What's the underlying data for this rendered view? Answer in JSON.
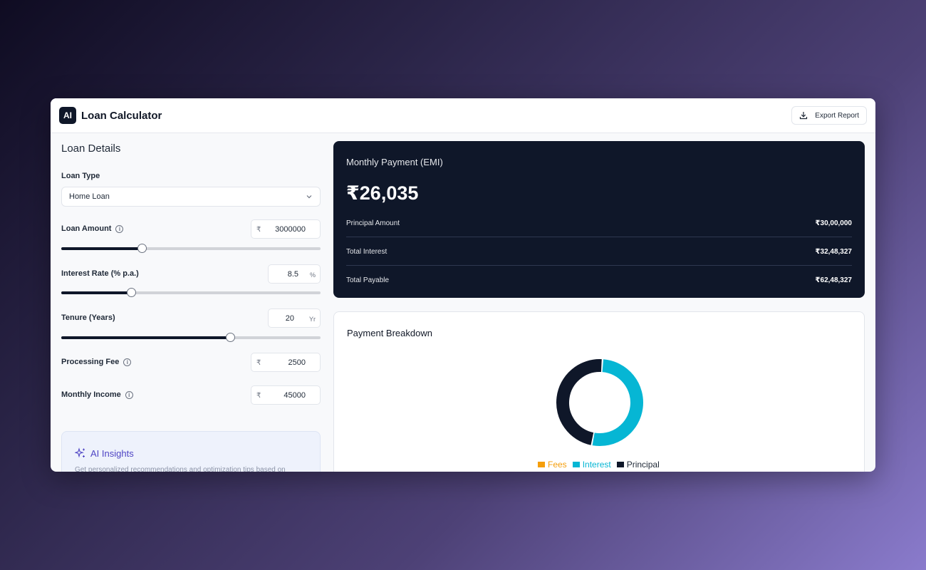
{
  "header": {
    "logo_text": "AI",
    "title": "Loan Calculator",
    "export_label": "Export Report"
  },
  "loan_details": {
    "title": "Loan Details",
    "loan_type": {
      "label": "Loan Type",
      "value": "Home Loan"
    },
    "loan_amount": {
      "label": "Loan Amount",
      "prefix": "₹",
      "value": "3000000",
      "slider_fraction": 0.31
    },
    "interest_rate": {
      "label": "Interest Rate (% p.a.)",
      "suffix": "%",
      "value": "8.5",
      "slider_fraction": 0.27
    },
    "tenure": {
      "label": "Tenure (Years)",
      "suffix": "Yr",
      "value": "20",
      "slider_fraction": 0.65
    },
    "processing_fee": {
      "label": "Processing Fee",
      "prefix": "₹",
      "value": "2500"
    },
    "monthly_income": {
      "label": "Monthly Income",
      "prefix": "₹",
      "value": "45000"
    }
  },
  "ai_insights": {
    "title": "AI Insights",
    "description": "Get personalized recommendations and optimization tips based on"
  },
  "emi": {
    "label": "Monthly Payment (EMI)",
    "value": "₹26,035",
    "rows": [
      {
        "label": "Principal Amount",
        "value": "₹30,00,000"
      },
      {
        "label": "Total Interest",
        "value": "₹32,48,327"
      },
      {
        "label": "Total Payable",
        "value": "₹62,48,327"
      }
    ]
  },
  "breakdown": {
    "title": "Payment Breakdown",
    "legend": [
      {
        "name": "Fees",
        "color": "#f59e0b"
      },
      {
        "name": "Interest",
        "color": "#06b6d4"
      },
      {
        "name": "Principal",
        "color": "#0f1729"
      }
    ]
  },
  "chart_data": {
    "type": "pie",
    "categories": [
      "Fees",
      "Interest",
      "Principal"
    ],
    "values": [
      2500,
      3248327,
      3000000
    ],
    "colors": [
      "#f59e0b",
      "#06b6d4",
      "#0f1729"
    ]
  }
}
